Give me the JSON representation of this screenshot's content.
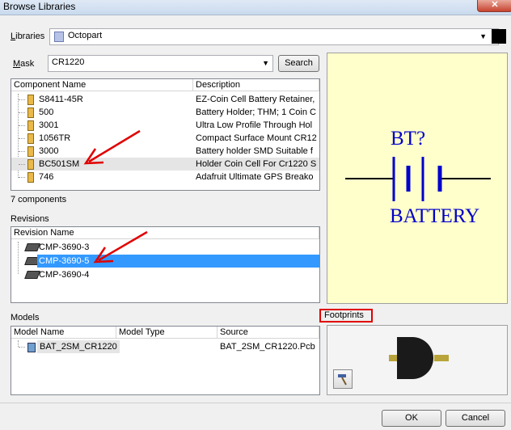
{
  "window": {
    "title": "Browse Libraries",
    "close_label": "✕"
  },
  "libraries": {
    "label_prefix": "L",
    "label_rest": "ibraries",
    "value": "Octopart"
  },
  "mask": {
    "label_prefix": "M",
    "label_rest": "ask",
    "value": "CR1220",
    "search_label": "Search"
  },
  "components": {
    "headers": [
      "Component Name",
      "Description"
    ],
    "rows": [
      {
        "name": "S8411-45R",
        "description": "EZ-Coin Cell Battery Retainer,"
      },
      {
        "name": "500",
        "description": "Battery Holder; THM; 1 Coin C"
      },
      {
        "name": "3001",
        "description": "Ultra Low Profile Through Hol"
      },
      {
        "name": "1056TR",
        "description": "Compact Surface Mount CR12"
      },
      {
        "name": "3000",
        "description": "Battery holder SMD Suitable f"
      },
      {
        "name": "BC501SM",
        "description": "Holder Coin Cell For Cr1220 S"
      },
      {
        "name": "746",
        "description": "Adafruit Ultimate GPS Breako"
      }
    ],
    "count_text": "7 components"
  },
  "revisions": {
    "section_label": "Revisions",
    "header": "Revision Name",
    "rows": [
      "CMP-3690-3",
      "CMP-3690-5",
      "CMP-3690-4"
    ]
  },
  "models": {
    "section_label": "Models",
    "headers": [
      "Model Name",
      "Model Type",
      "Source"
    ],
    "rows": [
      {
        "name": "BAT_2SM_CR1220",
        "type": "",
        "source": "BAT_2SM_CR1220.Pcb"
      }
    ]
  },
  "symbol": {
    "designator": "BT?",
    "comment": "BATTERY"
  },
  "footprints": {
    "label": "Footprints"
  },
  "buttons": {
    "ok": "OK",
    "cancel": "Cancel"
  },
  "colors": {
    "selection": "#3399ff",
    "symbol_blue": "#0000cc",
    "annotation_red": "#e00000",
    "preview_bg": "#ffffcc"
  }
}
